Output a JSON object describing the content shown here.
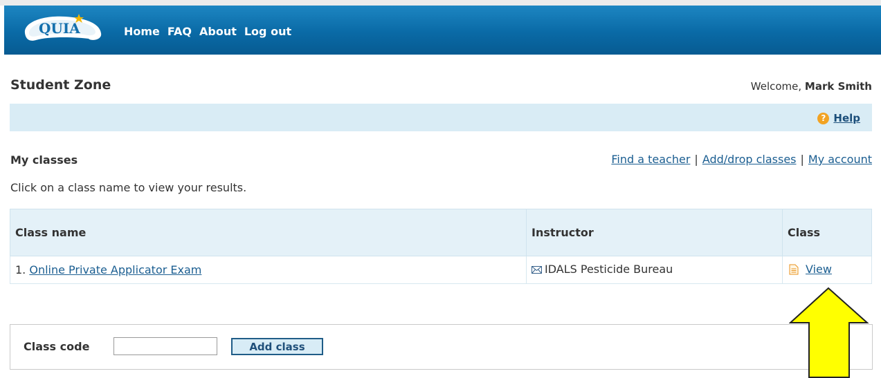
{
  "header": {
    "logo_text": "QUIA",
    "nav": [
      "Home",
      "FAQ",
      "About",
      "Log out"
    ]
  },
  "page": {
    "title": "Student Zone",
    "welcome_prefix": "Welcome, ",
    "user_name": "Mark Smith"
  },
  "help": {
    "label": "Help",
    "icon": "question-icon"
  },
  "classes": {
    "title": "My classes",
    "links": [
      "Find a teacher",
      "Add/drop classes",
      "My account"
    ],
    "instructions": "Click on a class name to view your results.",
    "columns": [
      "Class name",
      "Instructor",
      "Class"
    ],
    "rows": [
      {
        "number": "1.",
        "name": "Online Private Applicator Exam",
        "instructor": "IDALS Pesticide Bureau",
        "action": "View"
      }
    ]
  },
  "add_class": {
    "label": "Class code",
    "input_value": "",
    "button": "Add class"
  },
  "colors": {
    "header_blue": "#0a6aa6",
    "help_bar": "#d9ecf5",
    "link": "#1b5e91",
    "annotation_arrow": "#ffff00"
  }
}
